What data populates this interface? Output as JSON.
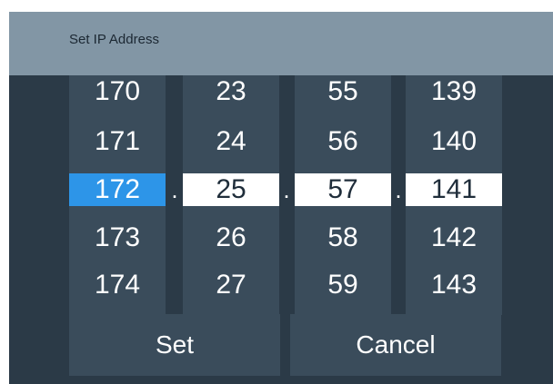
{
  "dialog": {
    "title": "Set IP Address"
  },
  "octets": [
    {
      "values": [
        "170",
        "171",
        "172",
        "173",
        "174"
      ],
      "selected_index": 2
    },
    {
      "values": [
        "23",
        "24",
        "25",
        "26",
        "27"
      ],
      "selected_index": 2
    },
    {
      "values": [
        "55",
        "56",
        "57",
        "58",
        "59"
      ],
      "selected_index": 2
    },
    {
      "values": [
        "139",
        "140",
        "141",
        "142",
        "143"
      ],
      "selected_index": 2
    }
  ],
  "separator": ".",
  "buttons": {
    "set": "Set",
    "cancel": "Cancel"
  },
  "colors": {
    "accent": "#2d95e8",
    "titlebar": "#8296a5",
    "background": "#2b3a47",
    "column": "#3a4c5b"
  }
}
